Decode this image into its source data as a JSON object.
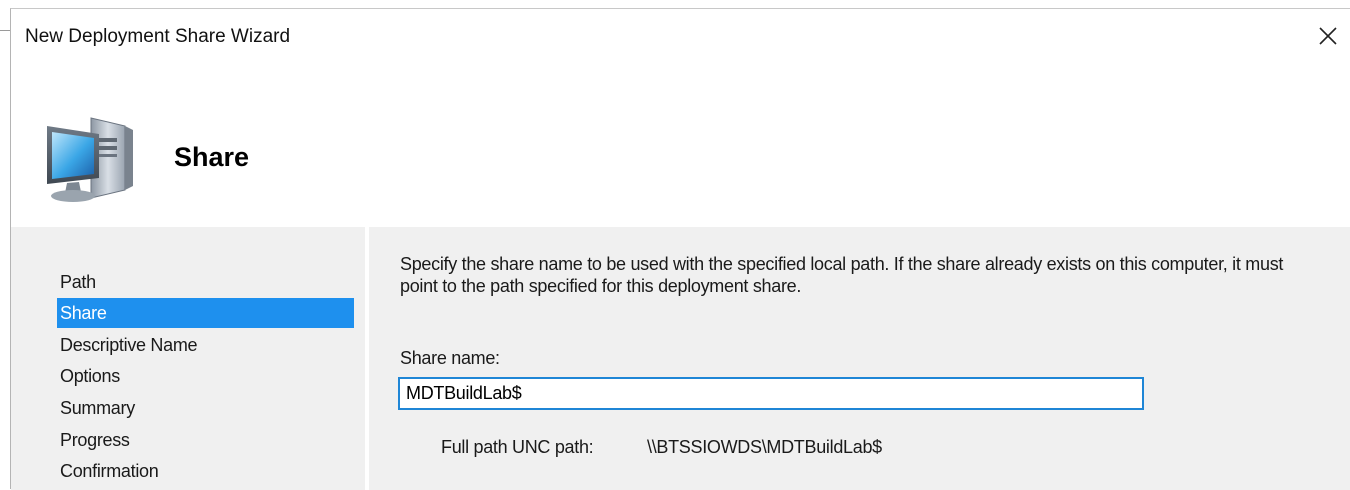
{
  "window": {
    "title": "New Deployment Share Wizard",
    "close_icon": "close-icon"
  },
  "banner": {
    "icon": "computer-icon",
    "title": "Share"
  },
  "nav": {
    "items": [
      {
        "label": "Path",
        "selected": false
      },
      {
        "label": "Share",
        "selected": true
      },
      {
        "label": "Descriptive Name",
        "selected": false
      },
      {
        "label": "Options",
        "selected": false
      },
      {
        "label": "Summary",
        "selected": false
      },
      {
        "label": "Progress",
        "selected": false
      },
      {
        "label": "Confirmation",
        "selected": false
      }
    ]
  },
  "content": {
    "description": "Specify the share name to be used with the specified local path.  If the share already exists on this computer, it must point to the path specified for this deployment share.",
    "share_name_label": "Share name:",
    "share_name_value": "MDTBuildLab$",
    "unc_label": "Full path UNC path:",
    "unc_value": "\\\\BTSSIOWDS\\MDTBuildLab$"
  },
  "colors": {
    "selection": "#1e90ee",
    "panel_background": "#f0f0f0",
    "input_border": "#1f86d6"
  }
}
